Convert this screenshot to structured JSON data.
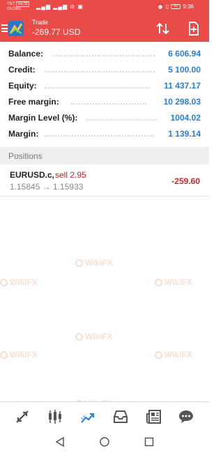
{
  "status_bar": {
    "carrier_line1": "TNT",
    "carrier_line2": "GLOBE",
    "badge": "VoLTE",
    "time": "9:36",
    "battery": "42"
  },
  "header": {
    "title": "Trade",
    "balance_change": "-269.77 USD",
    "accent_color": "#e84b48"
  },
  "summary": [
    {
      "label": "Balance:",
      "value": "6 606.94"
    },
    {
      "label": "Credit:",
      "value": "5 100.00"
    },
    {
      "label": "Equity:",
      "value": "11 437.17"
    },
    {
      "label": "Free margin:",
      "value": "10 298.03"
    },
    {
      "label": "Margin Level (%):",
      "value": "1004.02"
    },
    {
      "label": "Margin:",
      "value": "1 139.14"
    }
  ],
  "positions": {
    "section_label": "Positions",
    "items": [
      {
        "symbol": "EURUSD.c,",
        "side": "sell 2.95",
        "prices": "1.15845 → 1.15933",
        "profit": "-259.60"
      }
    ]
  },
  "watermark_text": "WikiFX",
  "bottom_nav": [
    "quotes-icon",
    "chart-icon",
    "trade-icon",
    "history-icon",
    "news-icon",
    "messages-icon"
  ],
  "colors": {
    "value_blue": "#2b7fd4",
    "loss_red": "#c62828",
    "active_nav": "#2b7fd4"
  }
}
